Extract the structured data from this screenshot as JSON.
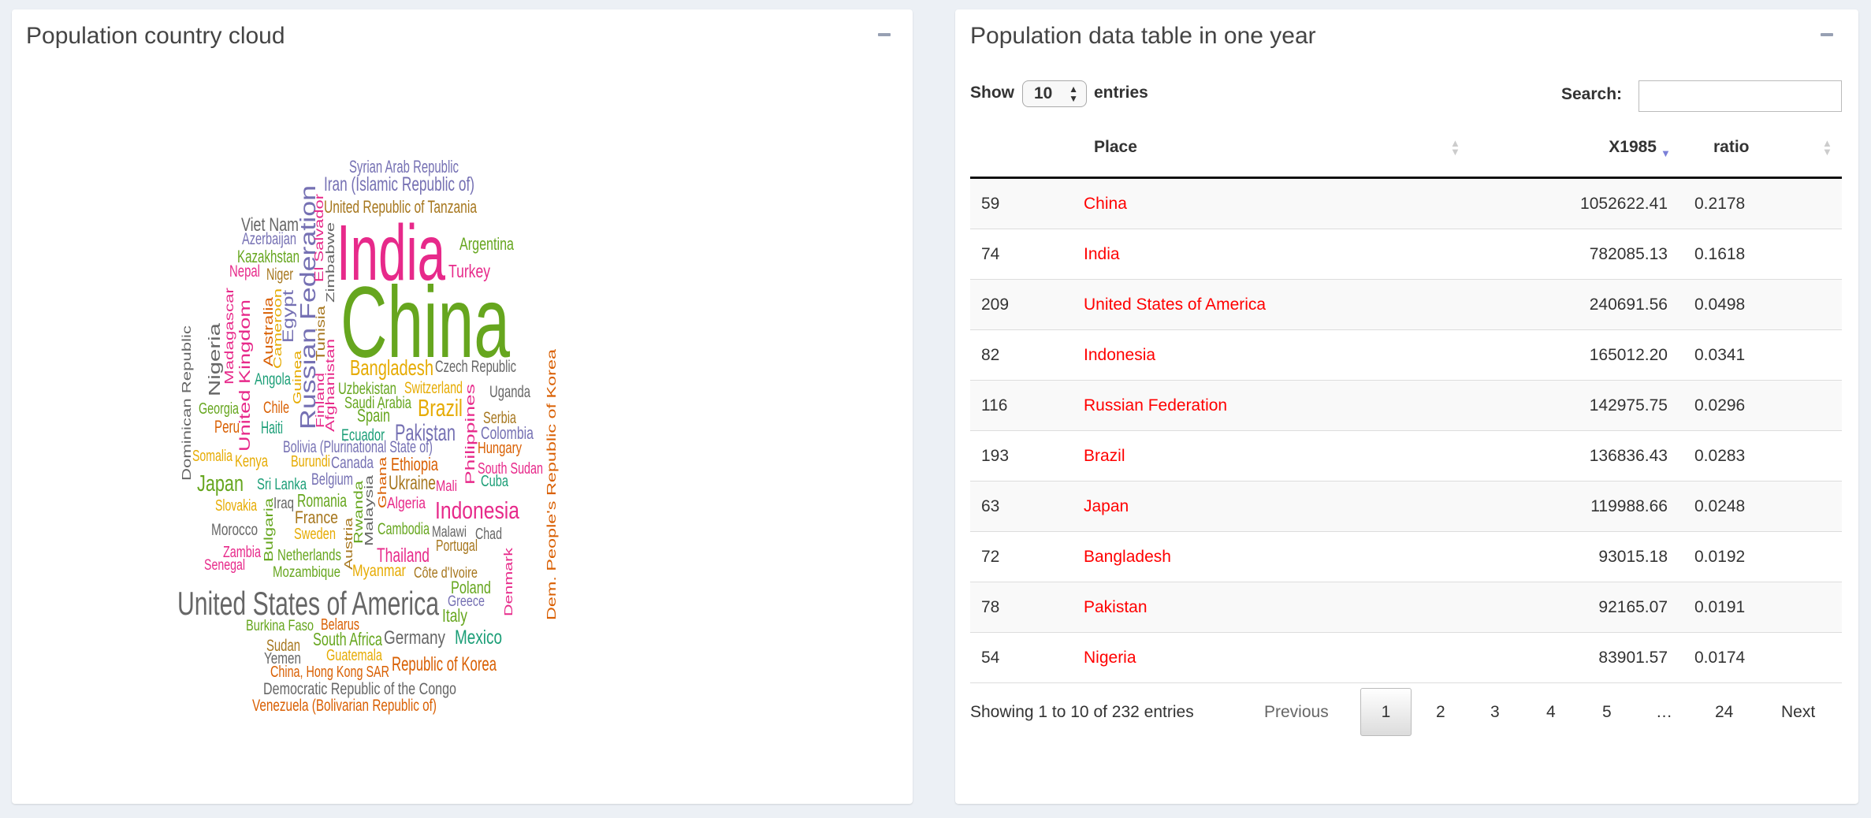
{
  "cloud_panel": {
    "title": "Population country cloud",
    "words": [
      {
        "text": "Syrian Arab Republic",
        "color": "#7570b3"
      },
      {
        "text": "Iran (Islamic Republic of)",
        "color": "#7570b3"
      },
      {
        "text": "United Republic of Tanzania",
        "color": "#a6761d"
      },
      {
        "text": "Viet Nam",
        "color": "#666666"
      },
      {
        "text": "Azerbaijan",
        "color": "#7570b3"
      },
      {
        "text": "Kazakhstan",
        "color": "#66a61e"
      },
      {
        "text": "Nepal",
        "color": "#e7298a"
      },
      {
        "text": "Niger",
        "color": "#a6761d"
      },
      {
        "text": "India",
        "color": "#e7298a"
      },
      {
        "text": "Argentina",
        "color": "#66a61e"
      },
      {
        "text": "Turkey",
        "color": "#e7298a"
      },
      {
        "text": "China",
        "color": "#66a61e"
      },
      {
        "text": "Bangladesh",
        "color": "#e6ab02"
      },
      {
        "text": "Czech Republic",
        "color": "#666666"
      },
      {
        "text": "Uzbekistan",
        "color": "#66a61e"
      },
      {
        "text": "Switzerland",
        "color": "#e6ab02"
      },
      {
        "text": "Uganda",
        "color": "#666666"
      },
      {
        "text": "Saudi Arabia",
        "color": "#66a61e"
      },
      {
        "text": "Brazil",
        "color": "#e6ab02"
      },
      {
        "text": "Serbia",
        "color": "#a6761d"
      },
      {
        "text": "Spain",
        "color": "#66a61e"
      },
      {
        "text": "Ecuador",
        "color": "#1b9e77"
      },
      {
        "text": "Pakistan",
        "color": "#7570b3"
      },
      {
        "text": "Colombia",
        "color": "#7570b3"
      },
      {
        "text": "Georgia",
        "color": "#66a61e"
      },
      {
        "text": "Chile",
        "color": "#d95f02"
      },
      {
        "text": "Peru",
        "color": "#d95f02"
      },
      {
        "text": "Haiti",
        "color": "#1b9e77"
      },
      {
        "text": "Angola",
        "color": "#1b9e77"
      },
      {
        "text": "Bolivia (Plurinational State of)",
        "color": "#7570b3"
      },
      {
        "text": "Hungary",
        "color": "#d95f02"
      },
      {
        "text": "Somalia",
        "color": "#e6ab02"
      },
      {
        "text": "Kenya",
        "color": "#e6ab02"
      },
      {
        "text": "Burundi",
        "color": "#e6ab02"
      },
      {
        "text": "Canada",
        "color": "#7570b3"
      },
      {
        "text": "Ethiopia",
        "color": "#d95f02"
      },
      {
        "text": "South Sudan",
        "color": "#e7298a"
      },
      {
        "text": "Japan",
        "color": "#66a61e"
      },
      {
        "text": "Sri Lanka",
        "color": "#1b9e77"
      },
      {
        "text": "Belgium",
        "color": "#7570b3"
      },
      {
        "text": "Ukraine",
        "color": "#a6761d"
      },
      {
        "text": "Mali",
        "color": "#e7298a"
      },
      {
        "text": "Cuba",
        "color": "#1b9e77"
      },
      {
        "text": "Slovakia",
        "color": "#e6ab02"
      },
      {
        "text": "Iraq",
        "color": "#666666"
      },
      {
        "text": "Romania",
        "color": "#66a61e"
      },
      {
        "text": "Algeria",
        "color": "#e7298a"
      },
      {
        "text": "Indonesia",
        "color": "#e7298a"
      },
      {
        "text": "France",
        "color": "#a6761d"
      },
      {
        "text": "Morocco",
        "color": "#666666"
      },
      {
        "text": "Sweden",
        "color": "#e6ab02"
      },
      {
        "text": "Cambodia",
        "color": "#66a61e"
      },
      {
        "text": "Malawi",
        "color": "#666666"
      },
      {
        "text": "Chad",
        "color": "#666666"
      },
      {
        "text": "Portugal",
        "color": "#a6761d"
      },
      {
        "text": "Zambia",
        "color": "#e7298a"
      },
      {
        "text": "Senegal",
        "color": "#e7298a"
      },
      {
        "text": "Netherlands",
        "color": "#66a61e"
      },
      {
        "text": "Thailand",
        "color": "#e7298a"
      },
      {
        "text": "Mozambique",
        "color": "#66a61e"
      },
      {
        "text": "Myanmar",
        "color": "#e6ab02"
      },
      {
        "text": "Côte d'Ivoire",
        "color": "#a6761d"
      },
      {
        "text": "Poland",
        "color": "#66a61e"
      },
      {
        "text": "United States of America",
        "color": "#666666"
      },
      {
        "text": "Greece",
        "color": "#7570b3"
      },
      {
        "text": "Italy",
        "color": "#66a61e"
      },
      {
        "text": "Burkina Faso",
        "color": "#66a61e"
      },
      {
        "text": "Belarus",
        "color": "#d95f02"
      },
      {
        "text": "South Africa",
        "color": "#66a61e"
      },
      {
        "text": "Germany",
        "color": "#666666"
      },
      {
        "text": "Mexico",
        "color": "#1b9e77"
      },
      {
        "text": "Sudan",
        "color": "#a6761d"
      },
      {
        "text": "Guatemala",
        "color": "#e6ab02"
      },
      {
        "text": "Yemen",
        "color": "#666666"
      },
      {
        "text": "Republic of Korea",
        "color": "#d95f02"
      },
      {
        "text": "China, Hong Kong SAR",
        "color": "#d95f02"
      },
      {
        "text": "Democratic Republic of the Congo",
        "color": "#666666"
      },
      {
        "text": "Venezuela (Bolivarian Republic of)",
        "color": "#d95f02"
      },
      {
        "text": "Russian Federation",
        "color": "#7570b3"
      },
      {
        "text": "El Salvador",
        "color": "#e7298a"
      },
      {
        "text": "Zimbabwe",
        "color": "#666666"
      },
      {
        "text": "Dominican Republic",
        "color": "#666666"
      },
      {
        "text": "Nigeria",
        "color": "#666666"
      },
      {
        "text": "Madagascar",
        "color": "#e7298a"
      },
      {
        "text": "United Kingdom",
        "color": "#e7298a"
      },
      {
        "text": "Australia",
        "color": "#d95f02"
      },
      {
        "text": "Cameroon",
        "color": "#e6ab02"
      },
      {
        "text": "Egypt",
        "color": "#7570b3"
      },
      {
        "text": "Guinea",
        "color": "#e6ab02"
      },
      {
        "text": "Tunisia",
        "color": "#a6761d"
      },
      {
        "text": "Finland",
        "color": "#e7298a"
      },
      {
        "text": "Afghanistan",
        "color": "#e7298a"
      },
      {
        "text": "Philippines",
        "color": "#e7298a"
      },
      {
        "text": "Dem. People's Republic of Korea",
        "color": "#d95f02"
      },
      {
        "text": "Ghana",
        "color": "#d95f02"
      },
      {
        "text": "Bulgaria",
        "color": "#66a61e"
      },
      {
        "text": "Austria",
        "color": "#a6761d"
      },
      {
        "text": "Rwanda",
        "color": "#66a61e"
      },
      {
        "text": "Malaysia",
        "color": "#666666"
      },
      {
        "text": "Denmark",
        "color": "#e7298a"
      }
    ]
  },
  "table_panel": {
    "title": "Population data table in one year",
    "show_label": "Show",
    "page_length": "10",
    "entries_label": "entries",
    "search_label": "Search:",
    "search_value": "",
    "columns": {
      "index": "",
      "place": "Place",
      "value": "X1985",
      "ratio": "ratio"
    },
    "sorted_column": "X1985",
    "sort_direction": "descending",
    "sort_color": "#7b80d8",
    "link_color": "#ff0000",
    "rows": [
      {
        "index": "59",
        "place": "China",
        "value": "1052622.41",
        "ratio": "0.2178"
      },
      {
        "index": "74",
        "place": "India",
        "value": "782085.13",
        "ratio": "0.1618"
      },
      {
        "index": "209",
        "place": "United States of America",
        "value": "240691.56",
        "ratio": "0.0498"
      },
      {
        "index": "82",
        "place": "Indonesia",
        "value": "165012.20",
        "ratio": "0.0341"
      },
      {
        "index": "116",
        "place": "Russian Federation",
        "value": "142975.75",
        "ratio": "0.0296"
      },
      {
        "index": "193",
        "place": "Brazil",
        "value": "136836.43",
        "ratio": "0.0283"
      },
      {
        "index": "63",
        "place": "Japan",
        "value": "119988.66",
        "ratio": "0.0248"
      },
      {
        "index": "72",
        "place": "Bangladesh",
        "value": "93015.18",
        "ratio": "0.0192"
      },
      {
        "index": "78",
        "place": "Pakistan",
        "value": "92165.07",
        "ratio": "0.0191"
      },
      {
        "index": "54",
        "place": "Nigeria",
        "value": "83901.57",
        "ratio": "0.0174"
      }
    ],
    "info": "Showing 1 to 10 of 232 entries",
    "pagination": {
      "previous": "Previous",
      "current": "1",
      "pages": [
        "2",
        "3",
        "4",
        "5",
        "…",
        "24"
      ],
      "next": "Next"
    }
  }
}
